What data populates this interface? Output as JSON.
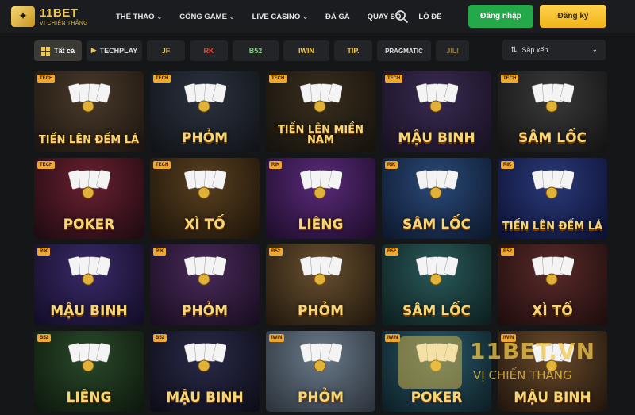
{
  "header": {
    "logo_title": "11BET",
    "logo_subtitle": "VỊ CHIẾN THẮNG",
    "nav": [
      {
        "label": "THỂ THAO",
        "dropdown": true
      },
      {
        "label": "CỔNG GAME",
        "dropdown": true
      },
      {
        "label": "LIVE CASINO",
        "dropdown": true
      },
      {
        "label": "ĐÁ GÀ",
        "dropdown": false
      },
      {
        "label": "QUAY SỐ",
        "dropdown": false
      },
      {
        "label": "LÔ ĐỀ",
        "dropdown": false
      }
    ],
    "login_label": "Đăng nhập",
    "register_label": "Đăng ký",
    "colors": {
      "login": "#23a84a",
      "register": "#f3c030",
      "brand": "#f3c94c"
    }
  },
  "filters": {
    "all_label": "Tất cả",
    "providers": [
      "TECHPLAY",
      "JF",
      "RK",
      "B52",
      "IWIN",
      "TIP.",
      "PRAGMATIC",
      "JILI"
    ],
    "sort_label": "Sắp xếp"
  },
  "games": [
    {
      "title": "TIẾN LÊN ĐẾM LÁ",
      "badge": "TECH"
    },
    {
      "title": "PHỎM",
      "badge": "TECH"
    },
    {
      "title": "TIẾN LÊN MIỀN NAM",
      "badge": "TECH"
    },
    {
      "title": "MẬU BINH",
      "badge": "TECH"
    },
    {
      "title": "SÂM LỐC",
      "badge": "TECH"
    },
    {
      "title": "POKER",
      "badge": "TECH"
    },
    {
      "title": "XÌ TỐ",
      "badge": "TECH"
    },
    {
      "title": "LIÊNG",
      "badge": "RIK"
    },
    {
      "title": "SÂM LỐC",
      "badge": "RIK"
    },
    {
      "title": "TIẾN LÊN ĐẾM LÁ",
      "badge": "RIK"
    },
    {
      "title": "MẬU BINH",
      "badge": "RIK"
    },
    {
      "title": "PHỎM",
      "badge": "RIK"
    },
    {
      "title": "PHỎM",
      "badge": "B52"
    },
    {
      "title": "SÂM LỐC",
      "badge": "B52"
    },
    {
      "title": "XÌ TỐ",
      "badge": "B52"
    },
    {
      "title": "LIÊNG",
      "badge": "B52"
    },
    {
      "title": "MẬU BINH",
      "badge": "B52"
    },
    {
      "title": "PHỎM",
      "badge": "IWIN"
    },
    {
      "title": "POKER",
      "badge": "IWIN"
    },
    {
      "title": "MẬU BINH",
      "badge": "IWIN"
    }
  ],
  "watermark": {
    "title": "11BET.VN",
    "subtitle": "VỊ CHIẾN THẮNG"
  }
}
